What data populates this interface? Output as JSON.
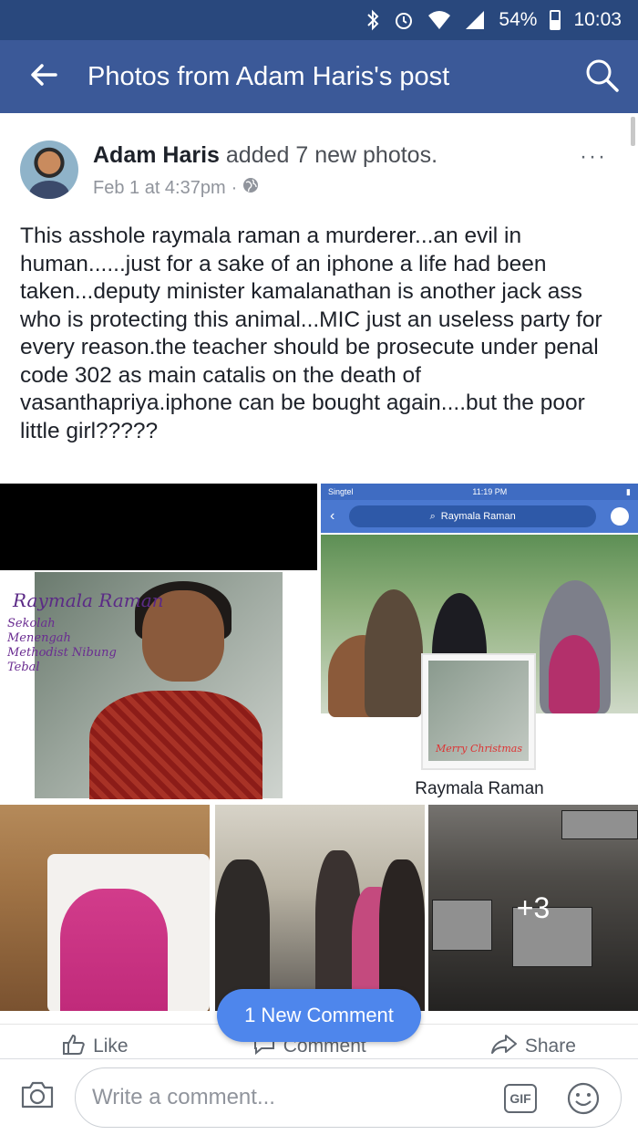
{
  "status_bar": {
    "battery": "54%",
    "time": "10:03"
  },
  "header": {
    "title": "Photos from Adam Haris's post"
  },
  "post": {
    "author": "Adam Haris",
    "action": "added 7 new photos.",
    "timestamp": "Feb 1 at 4:37pm",
    "separator": "·",
    "more": "···",
    "text": "This asshole raymala raman a murderer...an evil in human......just for a sake of an iphone a life had been taken...deputy minister kamalanathan is another jack ass who is protecting this animal...MIC just an useless party for every reason.the teacher should be prosecute under penal code 302 as main catalis on the death of vasanthapriya.iphone can be bought again....but the poor little girl?????"
  },
  "photos": {
    "photo1": {
      "name_caption": "Raymala Raman",
      "school_caption": [
        "Sekolah",
        "Menengah",
        "Methodist Nibung",
        "Tebal"
      ]
    },
    "photo2": {
      "carrier": "Singtel",
      "time": "11:19 PM",
      "search_text": "Raymala Raman",
      "inset_caption": "Merry Christmas",
      "caption": "Raymala Raman"
    },
    "more_count": "+3"
  },
  "new_comment_pill": "1 New Comment",
  "actions": {
    "like": "Like",
    "comment": "Comment",
    "share": "Share"
  },
  "composer": {
    "placeholder": "Write a comment...",
    "gif": "GIF"
  },
  "colors": {
    "status_bar": "#29487d",
    "app_bar": "#3b5998",
    "pill": "#4e86ec"
  }
}
